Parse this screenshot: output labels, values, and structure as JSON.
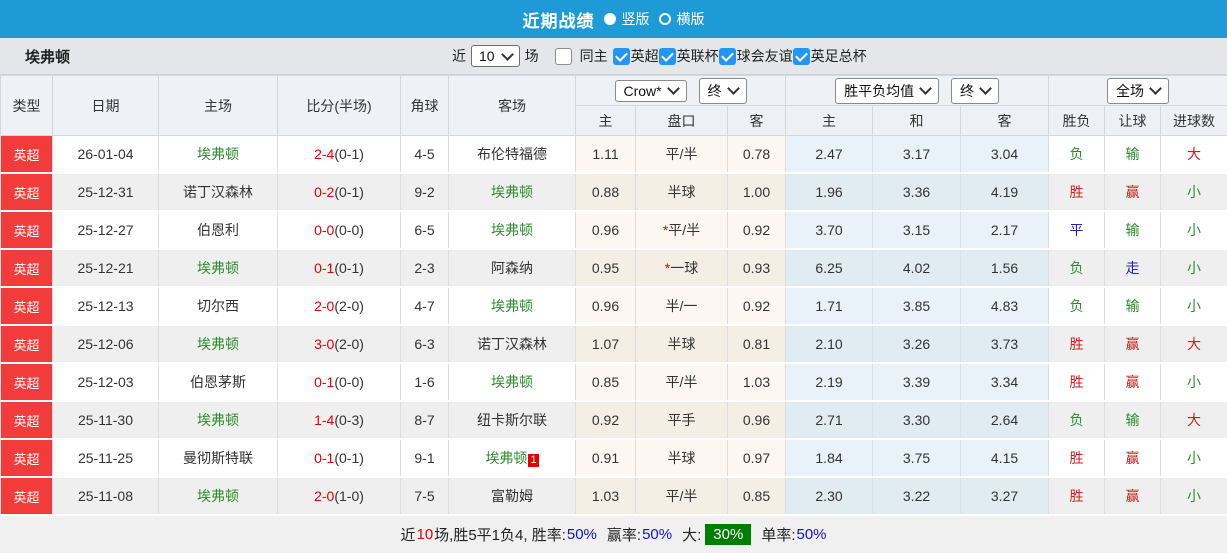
{
  "colors": {
    "topbar_bg": "#1e9bd7",
    "league_badge_bg": "#f23c3c",
    "self_team_green": "#2e8b2e",
    "score_red": "#e60000",
    "result_red": "#cc2020",
    "result_green": "#2e8b2e",
    "result_blue": "#2222bb",
    "big_rate_chip_bg": "#007e00",
    "checkbox_blue": "#2196f3"
  },
  "topbar": {
    "title": "近期战绩",
    "options": [
      {
        "label": "竖版",
        "selected": true
      },
      {
        "label": "横版",
        "selected": false
      }
    ]
  },
  "filterbar": {
    "team": "埃弗顿",
    "near_label": "近",
    "count_value": "10",
    "unit_label": "场",
    "same_home": {
      "label": "同主",
      "checked": false
    },
    "leagues": [
      {
        "label": "英超",
        "checked": true
      },
      {
        "label": "英联杯",
        "checked": true
      },
      {
        "label": "球会友谊",
        "checked": true
      },
      {
        "label": "英足总杯",
        "checked": true
      }
    ]
  },
  "header": {
    "cols": [
      "类型",
      "日期",
      "主场",
      "比分(半场)",
      "角球",
      "客场"
    ],
    "bookmaker_select": "Crow*",
    "final_select_1": "终",
    "avg_select": "胜平负均值",
    "final_select_2": "终",
    "scope_select": "全场",
    "odds_sub": [
      "主",
      "盘口",
      "客"
    ],
    "avg_sub": [
      "主",
      "和",
      "客"
    ],
    "result_sub": [
      "胜负",
      "让球",
      "进球数"
    ]
  },
  "rows": [
    {
      "league": "英超",
      "date": "26-01-04",
      "home": "埃弗顿",
      "home_self": true,
      "score": "2-4",
      "half": "(0-1)",
      "corner": "4-5",
      "away": "布伦特福德",
      "away_self": false,
      "away_badge": "",
      "odds": [
        "1.11",
        "平/半",
        "0.78"
      ],
      "handicap_star": false,
      "avg": [
        "2.47",
        "3.17",
        "3.04"
      ],
      "results": [
        {
          "t": "负",
          "c": "green"
        },
        {
          "t": "输",
          "c": "green"
        },
        {
          "t": "大",
          "c": "red"
        }
      ]
    },
    {
      "league": "英超",
      "date": "25-12-31",
      "home": "诺丁汉森林",
      "home_self": false,
      "score": "0-2",
      "half": "(0-1)",
      "corner": "9-2",
      "away": "埃弗顿",
      "away_self": true,
      "away_badge": "",
      "odds": [
        "0.88",
        "半球",
        "1.00"
      ],
      "handicap_star": false,
      "avg": [
        "1.96",
        "3.36",
        "4.19"
      ],
      "results": [
        {
          "t": "胜",
          "c": "red"
        },
        {
          "t": "赢",
          "c": "red"
        },
        {
          "t": "小",
          "c": "green"
        }
      ]
    },
    {
      "league": "英超",
      "date": "25-12-27",
      "home": "伯恩利",
      "home_self": false,
      "score": "0-0",
      "half": "(0-0)",
      "corner": "6-5",
      "away": "埃弗顿",
      "away_self": true,
      "away_badge": "",
      "odds": [
        "0.96",
        "平/半",
        "0.92"
      ],
      "handicap_star": true,
      "avg": [
        "3.70",
        "3.15",
        "2.17"
      ],
      "results": [
        {
          "t": "平",
          "c": "blue"
        },
        {
          "t": "输",
          "c": "green"
        },
        {
          "t": "小",
          "c": "green"
        }
      ]
    },
    {
      "league": "英超",
      "date": "25-12-21",
      "home": "埃弗顿",
      "home_self": true,
      "score": "0-1",
      "half": "(0-1)",
      "corner": "2-3",
      "away": "阿森纳",
      "away_self": false,
      "away_badge": "",
      "odds": [
        "0.95",
        "一球",
        "0.93"
      ],
      "handicap_star": true,
      "avg": [
        "6.25",
        "4.02",
        "1.56"
      ],
      "results": [
        {
          "t": "负",
          "c": "green"
        },
        {
          "t": "走",
          "c": "blue"
        },
        {
          "t": "小",
          "c": "green"
        }
      ]
    },
    {
      "league": "英超",
      "date": "25-12-13",
      "home": "切尔西",
      "home_self": false,
      "score": "2-0",
      "half": "(2-0)",
      "corner": "4-7",
      "away": "埃弗顿",
      "away_self": true,
      "away_badge": "",
      "odds": [
        "0.96",
        "半/一",
        "0.92"
      ],
      "handicap_star": false,
      "avg": [
        "1.71",
        "3.85",
        "4.83"
      ],
      "results": [
        {
          "t": "负",
          "c": "green"
        },
        {
          "t": "输",
          "c": "green"
        },
        {
          "t": "小",
          "c": "green"
        }
      ]
    },
    {
      "league": "英超",
      "date": "25-12-06",
      "home": "埃弗顿",
      "home_self": true,
      "score": "3-0",
      "half": "(2-0)",
      "corner": "6-3",
      "away": "诺丁汉森林",
      "away_self": false,
      "away_badge": "",
      "odds": [
        "1.07",
        "半球",
        "0.81"
      ],
      "handicap_star": false,
      "avg": [
        "2.10",
        "3.26",
        "3.73"
      ],
      "results": [
        {
          "t": "胜",
          "c": "red"
        },
        {
          "t": "赢",
          "c": "red"
        },
        {
          "t": "大",
          "c": "red"
        }
      ]
    },
    {
      "league": "英超",
      "date": "25-12-03",
      "home": "伯恩茅斯",
      "home_self": false,
      "score": "0-1",
      "half": "(0-0)",
      "corner": "1-6",
      "away": "埃弗顿",
      "away_self": true,
      "away_badge": "",
      "odds": [
        "0.85",
        "平/半",
        "1.03"
      ],
      "handicap_star": false,
      "avg": [
        "2.19",
        "3.39",
        "3.34"
      ],
      "results": [
        {
          "t": "胜",
          "c": "red"
        },
        {
          "t": "赢",
          "c": "red"
        },
        {
          "t": "小",
          "c": "green"
        }
      ]
    },
    {
      "league": "英超",
      "date": "25-11-30",
      "home": "埃弗顿",
      "home_self": true,
      "score": "1-4",
      "half": "(0-3)",
      "corner": "8-7",
      "away": "纽卡斯尔联",
      "away_self": false,
      "away_badge": "",
      "odds": [
        "0.92",
        "平手",
        "0.96"
      ],
      "handicap_star": false,
      "avg": [
        "2.71",
        "3.30",
        "2.64"
      ],
      "results": [
        {
          "t": "负",
          "c": "green"
        },
        {
          "t": "输",
          "c": "green"
        },
        {
          "t": "大",
          "c": "red"
        }
      ]
    },
    {
      "league": "英超",
      "date": "25-11-25",
      "home": "曼彻斯特联",
      "home_self": false,
      "score": "0-1",
      "half": "(0-1)",
      "corner": "9-1",
      "away": "埃弗顿",
      "away_self": true,
      "away_badge": "1",
      "odds": [
        "0.91",
        "半球",
        "0.97"
      ],
      "handicap_star": false,
      "avg": [
        "1.84",
        "3.75",
        "4.15"
      ],
      "results": [
        {
          "t": "胜",
          "c": "red"
        },
        {
          "t": "赢",
          "c": "red"
        },
        {
          "t": "小",
          "c": "green"
        }
      ]
    },
    {
      "league": "英超",
      "date": "25-11-08",
      "home": "埃弗顿",
      "home_self": true,
      "score": "2-0",
      "half": "(1-0)",
      "corner": "7-5",
      "away": "富勒姆",
      "away_self": false,
      "away_badge": "",
      "odds": [
        "1.03",
        "平/半",
        "0.85"
      ],
      "handicap_star": false,
      "avg": [
        "2.30",
        "3.22",
        "3.27"
      ],
      "results": [
        {
          "t": "胜",
          "c": "red"
        },
        {
          "t": "赢",
          "c": "red"
        },
        {
          "t": "小",
          "c": "green"
        }
      ]
    }
  ],
  "footer": {
    "seg_near": "近",
    "seg_count": "10",
    "seg_record": "场,胜5平1负4, 胜率:",
    "win_rate": "50%",
    "seg_handicap": "赢率:",
    "handicap_rate": "50%",
    "seg_big": "大:",
    "big_rate": "30%",
    "seg_single": "单率:",
    "single_rate": "50%"
  }
}
